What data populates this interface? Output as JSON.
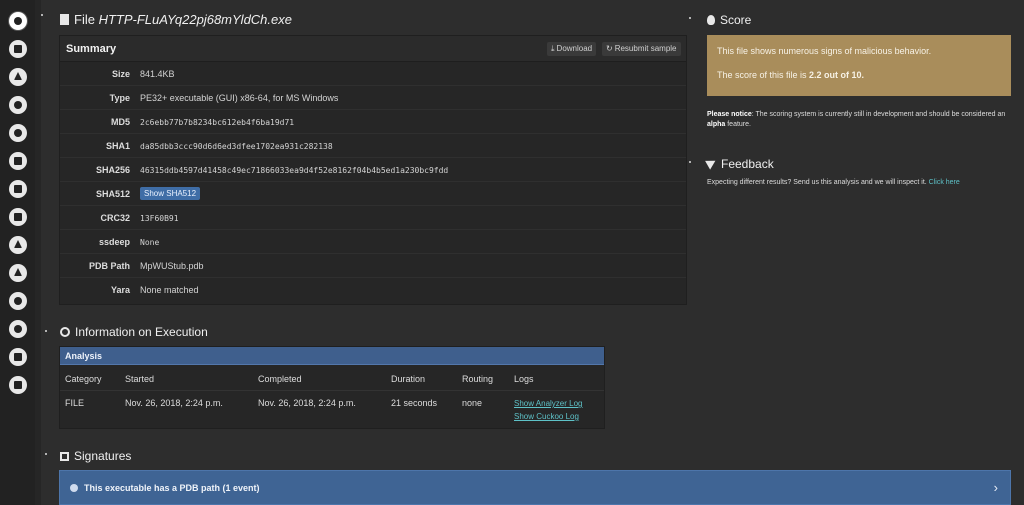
{
  "sidebar": {
    "items": [
      {
        "icon": "home-icon"
      },
      {
        "icon": "book-icon"
      },
      {
        "icon": "pencil-icon"
      },
      {
        "icon": "share-icon"
      },
      {
        "icon": "globe-icon"
      },
      {
        "icon": "file-icon"
      },
      {
        "icon": "list-icon"
      },
      {
        "icon": "list-alt-icon"
      },
      {
        "icon": "shuffle-icon"
      },
      {
        "icon": "download-icon"
      },
      {
        "icon": "power-icon"
      },
      {
        "icon": "cogs-icon"
      },
      {
        "icon": "bug-icon"
      },
      {
        "icon": "unlock-icon"
      }
    ]
  },
  "file": {
    "prefix": "File",
    "name": "HTTP-FLuAYq22pj68mYldCh.exe"
  },
  "summary": {
    "title": "Summary",
    "download_label": "Download",
    "resubmit_label": "Resubmit sample",
    "rows": [
      {
        "key": "Size",
        "value": "841.4KB"
      },
      {
        "key": "Type",
        "value": "PE32+ executable (GUI) x86-64, for MS Windows"
      },
      {
        "key": "MD5",
        "value": "2c6ebb77b7b8234bc612eb4f6ba19d71"
      },
      {
        "key": "SHA1",
        "value": "da85dbb3ccc90d6d6ed3dfee1702ea931c282138"
      },
      {
        "key": "SHA256",
        "value": "46315ddb4597d41458c49ec71866033ea9d4f52e8162f04b4b5ed1a230bc9fdd"
      },
      {
        "key": "SHA512",
        "button": "Show SHA512"
      },
      {
        "key": "CRC32",
        "value": "13F60B91"
      },
      {
        "key": "ssdeep",
        "value": "None"
      },
      {
        "key": "PDB Path",
        "value": "MpWUStub.pdb"
      },
      {
        "key": "Yara",
        "value": "None matched"
      }
    ]
  },
  "score": {
    "title": "Score",
    "line1": "This file shows numerous signs of malicious behavior.",
    "line2_prefix": "The score of this file is ",
    "line2_value": "2.2 out of 10.",
    "notice_label": "Please notice",
    "notice_text": ": The scoring system is currently still in development and should be considered an ",
    "notice_alpha": "alpha",
    "notice_end": " feature.",
    "color": "#a98d5b"
  },
  "feedback": {
    "title": "Feedback",
    "text": "Expecting different results? Send us this analysis and we will inspect it. ",
    "link": "Click here"
  },
  "execution": {
    "title": "Information on Execution",
    "panel_title": "Analysis",
    "headers": [
      "Category",
      "Started",
      "Completed",
      "Duration",
      "Routing",
      "Logs"
    ],
    "row": {
      "category": "FILE",
      "started": "Nov. 26, 2018, 2:24 p.m.",
      "completed": "Nov. 26, 2018, 2:24 p.m.",
      "duration": "21 seconds",
      "routing": "none",
      "log1": "Show Analyzer Log",
      "log2": "Show Cuckoo Log"
    }
  },
  "signatures": {
    "title": "Signatures",
    "item": "This executable has a PDB path (1 event)"
  }
}
